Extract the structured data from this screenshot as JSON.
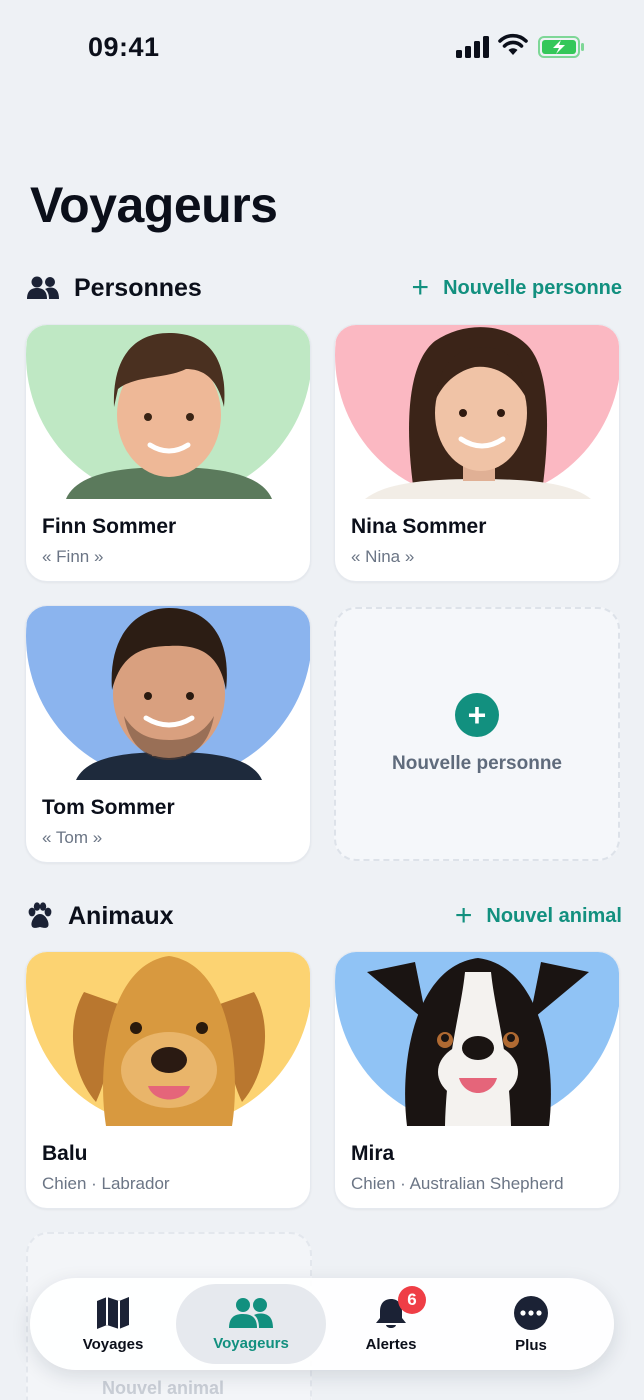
{
  "status_bar": {
    "time": "09:41"
  },
  "page": {
    "title": "Voyageurs"
  },
  "people_section": {
    "title": "Personnes",
    "icon": "people-icon",
    "action_label": "Nouvelle personne",
    "cards": [
      {
        "name": "Finn Sommer",
        "nickname": "« Finn »",
        "photo_bg": "#bfe8c4"
      },
      {
        "name": "Nina Sommer",
        "nickname": "« Nina »",
        "photo_bg": "#fbb8c2"
      },
      {
        "name": "Tom Sommer",
        "nickname": "« Tom »",
        "photo_bg": "#8bb4ee"
      }
    ],
    "add_card_label": "Nouvelle personne"
  },
  "animals_section": {
    "title": "Animaux",
    "icon": "paw-icon",
    "action_label": "Nouvel animal",
    "cards": [
      {
        "name": "Balu",
        "detail": "Chien · Labrador",
        "photo_bg": "#fcd372"
      },
      {
        "name": "Mira",
        "detail": "Chien · Australian Shepherd",
        "photo_bg": "#90c3f5"
      }
    ],
    "add_card_label": "Nouvel animal"
  },
  "tab_bar": {
    "tabs": [
      {
        "label": "Voyages",
        "icon": "map-icon"
      },
      {
        "label": "Voyageurs",
        "icon": "people-icon",
        "active": true
      },
      {
        "label": "Alertes",
        "icon": "bell-icon",
        "badge": "6"
      },
      {
        "label": "Plus",
        "icon": "more-icon"
      }
    ]
  },
  "colors": {
    "accent": "#12907f",
    "badge": "#ef3e46",
    "background": "#eef1f5"
  }
}
